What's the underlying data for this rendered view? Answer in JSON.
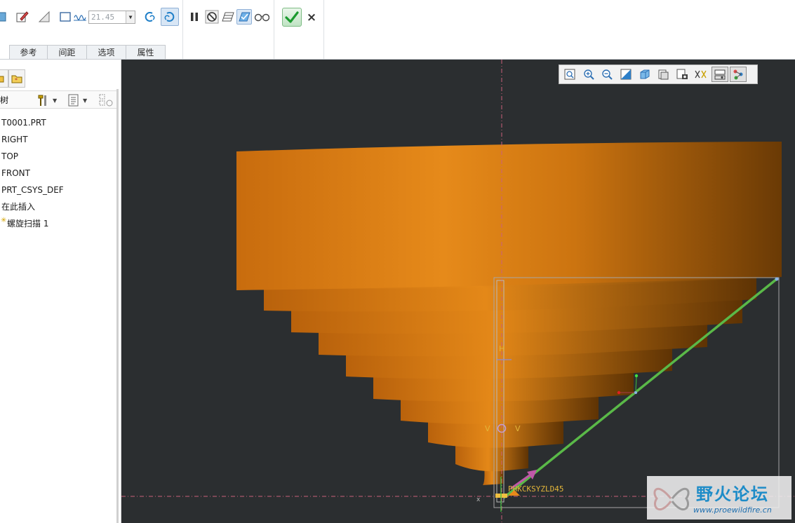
{
  "ribbon": {
    "dimension_value": "21.45",
    "tabs": [
      "参考",
      "间距",
      "选项",
      "属性"
    ],
    "icons": [
      "surface-icon",
      "sketch-pencil-icon",
      "thin-icon",
      "profile-rect-icon",
      "pitch-icon",
      "left-hand-icon",
      "right-hand-icon",
      "pause-icon",
      "no-preview-icon",
      "geometry-preview-icon",
      "verify-preview-icon",
      "glasses-icon"
    ]
  },
  "actions": {
    "ok_icon": "check-icon",
    "cancel_label": "×"
  },
  "left_panel": {
    "tab_icons": [
      "model-tree-tab-icon",
      "folder-tab-icon"
    ],
    "tree_title": "树",
    "tree_items": [
      {
        "label": "T0001.PRT",
        "mark": ""
      },
      {
        "label": "RIGHT",
        "mark": ""
      },
      {
        "label": "TOP",
        "mark": ""
      },
      {
        "label": "FRONT",
        "mark": ""
      },
      {
        "label": "PRT_CSYS_DEF",
        "mark": ""
      },
      {
        "label": "在此插入",
        "mark": ""
      },
      {
        "label": "螺旋扫描 1",
        "mark": "✳"
      }
    ]
  },
  "viewport": {
    "background": "#2b2e30",
    "model_color": "#e8891a",
    "trajectory_color": "#5ab948",
    "view_toolbar_icons": [
      "refit-icon",
      "zoom-in-icon",
      "zoom-out-icon",
      "repaint-icon",
      "display-style-icon",
      "saved-views-icon",
      "view-manager-icon",
      "annotation-display-icon",
      "datum-display-icon",
      "spin-center-icon"
    ],
    "labels": {
      "h": "H",
      "v_left": "V",
      "v_right": "V",
      "dim_text": "PHKCKSYZLD45",
      "x_mark": "x"
    }
  },
  "watermark": {
    "title": "野火论坛",
    "url": "www.proewildfire.cn"
  }
}
